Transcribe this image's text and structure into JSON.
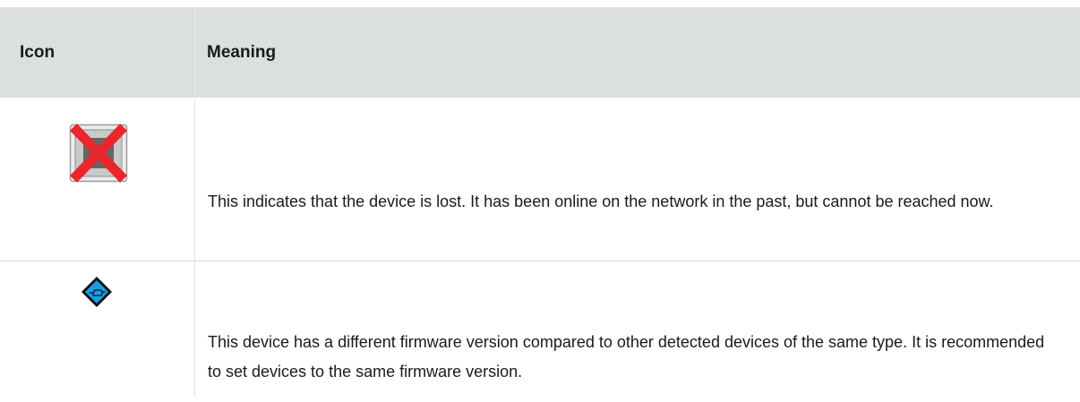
{
  "table": {
    "headers": {
      "icon": "Icon",
      "meaning": "Meaning"
    },
    "rows": [
      {
        "icon": "device-lost-icon",
        "meaning": "This indicates that the device is lost. It has been online on the network in the past, but cannot be reached now."
      },
      {
        "icon": "firmware-mismatch-icon",
        "meaning": "This device has a different firmware version compared to other detected devices of the same type. It is recommended to set devices to the same firmware version."
      }
    ]
  },
  "colors": {
    "header_bg": "#dcdfe0",
    "lost_x": "#e8262b",
    "firmware_blue": "#1e9be0"
  }
}
